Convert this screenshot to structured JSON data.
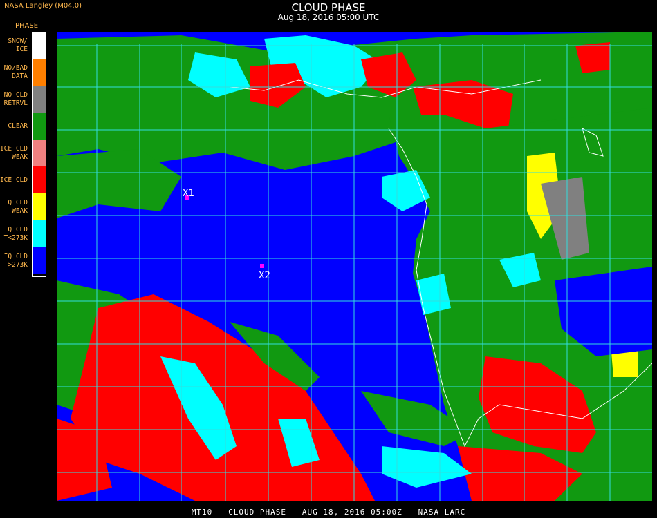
{
  "header": {
    "source": "NASA Langley (M04.0)",
    "product_label": "PHASE",
    "title": "CLOUD PHASE",
    "datetime": "Aug 18, 2016 05:00 UTC"
  },
  "legend": [
    {
      "label": "SNOW/\nICE",
      "color": "#ffffff"
    },
    {
      "label": "NO/BAD\nDATA",
      "color": "#ff7f00"
    },
    {
      "label": "NO CLD\nRETRVL",
      "color": "#808080"
    },
    {
      "label": "CLEAR",
      "color": "#119911"
    },
    {
      "label": "ICE CLD\nWEAK",
      "color": "#f08080"
    },
    {
      "label": "ICE CLD",
      "color": "#ff0000"
    },
    {
      "label": "LIQ CLD\nWEAK",
      "color": "#ffff00"
    },
    {
      "label": "LIQ CLD\nT<273K",
      "color": "#00ffff"
    },
    {
      "label": "LIQ CLD\nT>273K",
      "color": "#0000ff"
    }
  ],
  "markers": [
    {
      "label": "X1",
      "color": "#ff00ff"
    },
    {
      "label": "X2",
      "color": "#ff00ff"
    }
  ],
  "colors": {
    "grid": "#33dddd",
    "coastline": "#ffffff"
  },
  "footer": "MT10   CLOUD PHASE   AUG 18, 2016 05:00Z   NASA LARC"
}
